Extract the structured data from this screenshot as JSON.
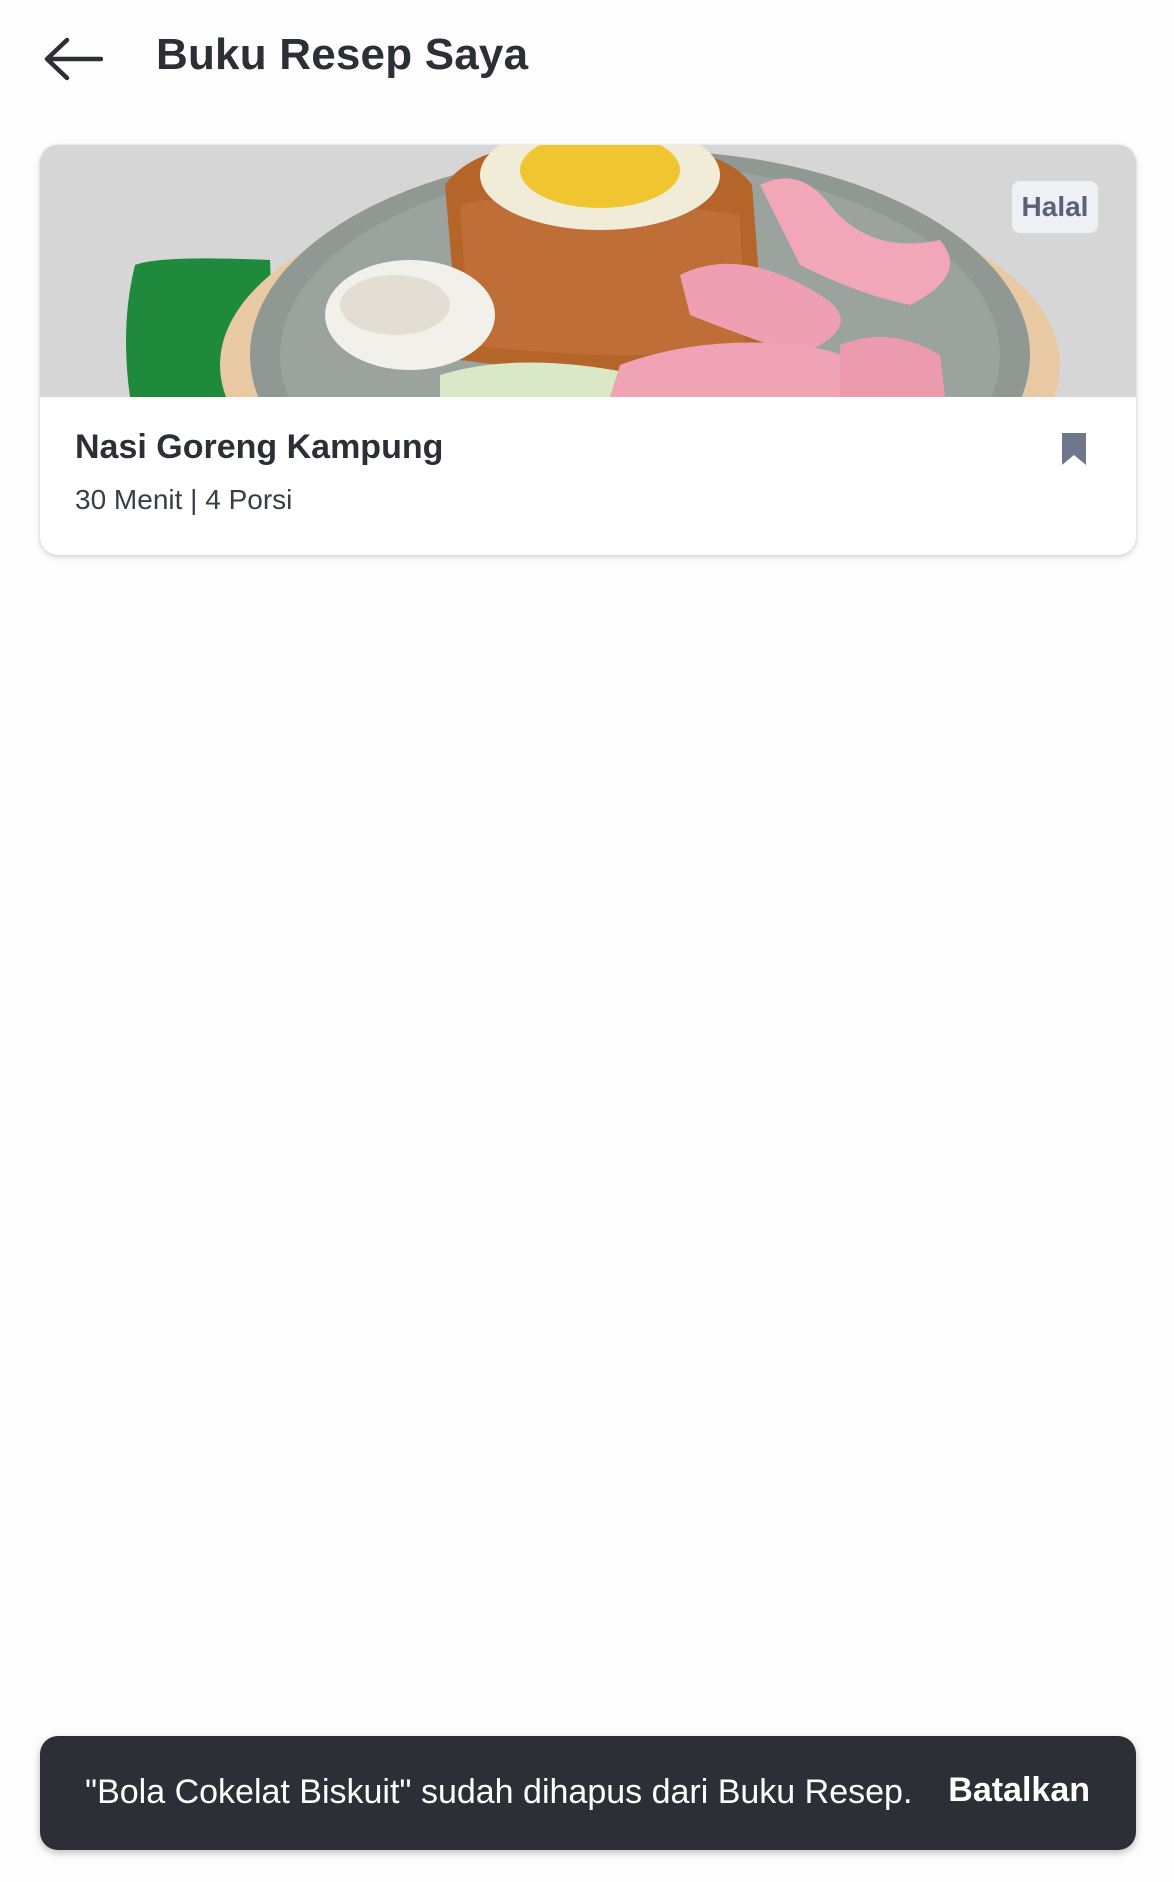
{
  "header": {
    "back_icon": "arrow-left-icon",
    "title": "Buku Resep Saya"
  },
  "recipes": [
    {
      "title": "Nasi Goreng Kampung",
      "meta": "30 Menit | 4 Porsi",
      "badge": "Halal",
      "image_icon": "fried-rice-photo",
      "bookmark_icon": "bookmark-icon",
      "bookmarked": true
    }
  ],
  "snackbar": {
    "message": "\"Bola Cokelat Biskuit\" sudah dihapus dari Buku Resep.",
    "action_label": "Batalkan"
  },
  "colors": {
    "text_primary": "#2c2f36",
    "snackbar_bg": "#2c2f36",
    "badge_bg": "#eef0f5",
    "badge_text": "#5b6275",
    "bookmark": "#6f778c",
    "background": "#fdfdfd"
  }
}
